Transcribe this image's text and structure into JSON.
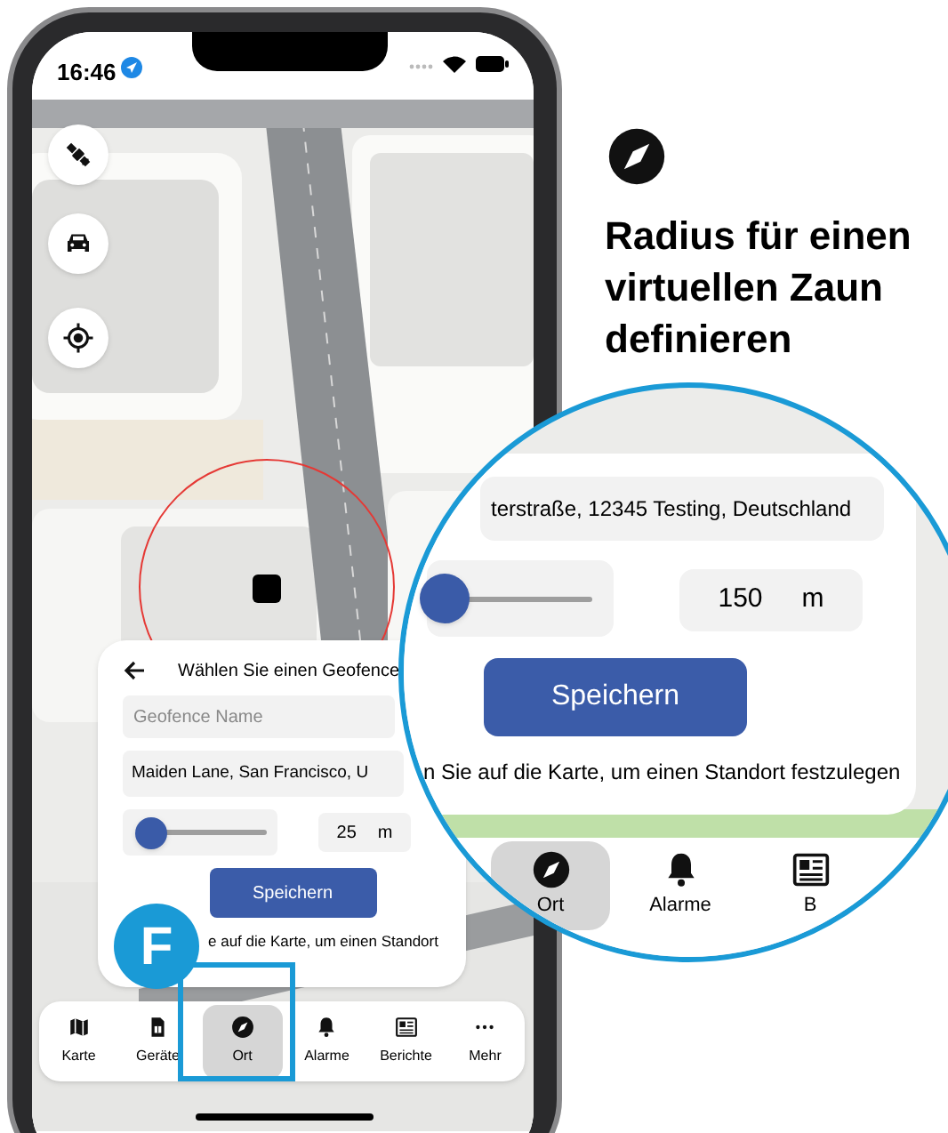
{
  "status_bar": {
    "time": "16:46"
  },
  "panel": {
    "title": "Wählen Sie einen Geofence",
    "name_placeholder": "Geofence Name",
    "address": "Maiden Lane, San Francisco, U",
    "radius": {
      "level": 0,
      "value": "25",
      "unit": "m"
    },
    "save_button": "Speichern",
    "hint": "e auf die Karte, um einen Standort"
  },
  "badge": {
    "letter": "F"
  },
  "tabs": [
    {
      "label": "Karte",
      "selected": false
    },
    {
      "label": "Geräte",
      "selected": false
    },
    {
      "label": "Ort",
      "selected": true
    },
    {
      "label": "Alarme",
      "selected": false
    },
    {
      "label": "Berichte",
      "selected": false
    },
    {
      "label": "Mehr",
      "selected": false
    }
  ],
  "feature": {
    "heading": "Radius für einen virtuellen Zaun definieren"
  },
  "magnifier": {
    "address": "terstraße, 12345 Testing, Deutschland",
    "radius": {
      "level": 0,
      "value": "150",
      "unit": "m"
    },
    "save_button": "Speichern",
    "hint": "n Sie auf die Karte, um einen Standort festzulegen",
    "tabs": [
      {
        "label": "Ort",
        "selected": true
      },
      {
        "label": "Alarme",
        "selected": false
      },
      {
        "label": "B",
        "selected": false
      }
    ]
  }
}
